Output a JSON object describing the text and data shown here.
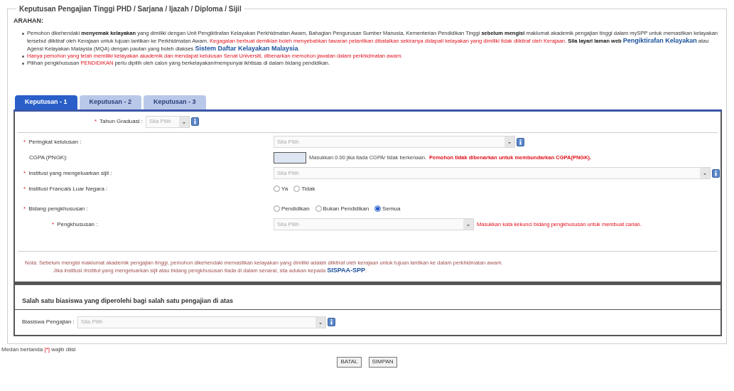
{
  "legend": "Keputusan Pengajian Tinggi PHD / Sarjana / Ijazah / Diploma / Sijil",
  "instructions_title": "ARAHAN:",
  "instructions": [
    {
      "segments": [
        {
          "kind": "plain",
          "text": "Pemohon dikehendaki "
        },
        {
          "kind": "bold",
          "text": "menyemak kelayakan"
        },
        {
          "kind": "plain",
          "text": " yang dimiliki dengan Unit Pengiktirafan Kelayakan Perkhidmatan Awam, Bahagian Pengurusan Sumber Manusia, Kementerian Pendidikan Tinggi "
        },
        {
          "kind": "bold",
          "text": "sebelum mengisi"
        },
        {
          "kind": "plain",
          "text": " maklumat akademik pengajian tinggi dalam mySPP untuk memastikan kelayakan tersebut diiktiraf oleh Kerajaan untuk tujuan lantikan ke Perkhidmatan Awam. "
        },
        {
          "kind": "red",
          "text": "Kegagalan berbuat demikian boleh menyebabkan tawaran pelantikan dibatalkan sekiranya didapati kelayakan yang dimiliki tidak diiktiraf oleh Kerajaan."
        },
        {
          "kind": "bold",
          "text": " Sila layari laman web "
        },
        {
          "kind": "link",
          "text": "Pengiktirafan Kelayakan"
        },
        {
          "kind": "plain",
          "text": " atau Agensi Kelayakan Malaysia (MQA) dengan pautan yang boleh diakses "
        },
        {
          "kind": "link",
          "text": "Sistem Daftar Kelayakan Malaysia"
        },
        {
          "kind": "plain",
          "text": "."
        }
      ]
    },
    {
      "segments": [
        {
          "kind": "red",
          "text": "Hanya pemohon yang telah memiliki kelayakan akademik dan mendapat kelulusan Senat Universiti, dibenarkan memohon jawatan dalam perkhidmatan awam."
        }
      ]
    },
    {
      "segments": [
        {
          "kind": "plain",
          "text": "Pilihan pengkhususan "
        },
        {
          "kind": "red",
          "text": "PENDIDIKAN"
        },
        {
          "kind": "plain",
          "text": " perlu dipilih oleh calon yang berkelayakan/mempunyai ikhtisas di dalam bidang pendidikan."
        }
      ]
    }
  ],
  "tabs": [
    {
      "label": "Keputusan - 1",
      "selected": true
    },
    {
      "label": "Keputusan - 2",
      "selected": false
    },
    {
      "label": "Keputusan - 3",
      "selected": false
    }
  ],
  "graduation_year": {
    "label": "Tahun Graduasi :",
    "required_mark": "*",
    "placeholder": "Sila Pilih",
    "info": true
  },
  "rows": [
    {
      "kind": "select",
      "label": "Peringkat kelulusan :",
      "required_mark": "*",
      "placeholder": "Sila Pilih",
      "info": true
    },
    {
      "kind": "input",
      "label": "CGPA (PNGK):",
      "hint": "Masukkan 0.00 jika tiada CGPA/ tidak berkenaan.",
      "warning": "Pemohon tidak dibenarkan untuk membundarkan CGPA(PNGK)."
    },
    {
      "kind": "select",
      "label": "Institusi yang mengeluarkan sijil :",
      "required_mark": "*",
      "placeholder": "Sila Pilih",
      "info": true
    },
    {
      "kind": "radio",
      "label": "Institusi Francais Luar Negara :",
      "required_mark": "*",
      "options": [
        {
          "label": "Ya",
          "selected": false
        },
        {
          "label": "Tidak",
          "selected": false
        }
      ]
    },
    {
      "kind": "radio",
      "label": "Bidang pengkhususan :",
      "required_mark": "*",
      "options": [
        {
          "label": "Pendidikan",
          "selected": false
        },
        {
          "label": "Bukan Pendidikan",
          "selected": false
        },
        {
          "label": "Semua",
          "selected": true
        }
      ]
    },
    {
      "kind": "select",
      "label": "Pengkhususan :",
      "required_mark": "*",
      "placeholder": "Sila Pilih",
      "warning": "Masukkan kata kekunci bidang pengkhususan untuk membuat carian."
    }
  ],
  "note": {
    "line_1": "Nota: Sebelum mengisi maklumat akademik pengajian tinggi, pemohon dikehendaki memastikan kelayakan yang dimiliki adalah diiktiraf oleh kerajaan untuk tujuan lantikan ke dalam perkhidmatan awam.",
    "line_2": "Jika institusi /institut yang mengeluarkan sijil atau bidang pengkhususan tiada di dalam senarai, sila adukan kepada ",
    "link": "SISPAA-SPP",
    "end": "."
  },
  "scholarship": {
    "heading": "Salah satu biasiswa yang diperolehi bagi salah satu pengajian di atas",
    "label": "Biasiswa Pengajian :",
    "placeholder": "Sila Pilih",
    "info": true
  },
  "footer_note": {
    "before": "Medan bertanda ",
    "mark": "[*]",
    "after": " wajib diisi"
  },
  "buttons": [
    "BATAL",
    "SIMPAN"
  ]
}
